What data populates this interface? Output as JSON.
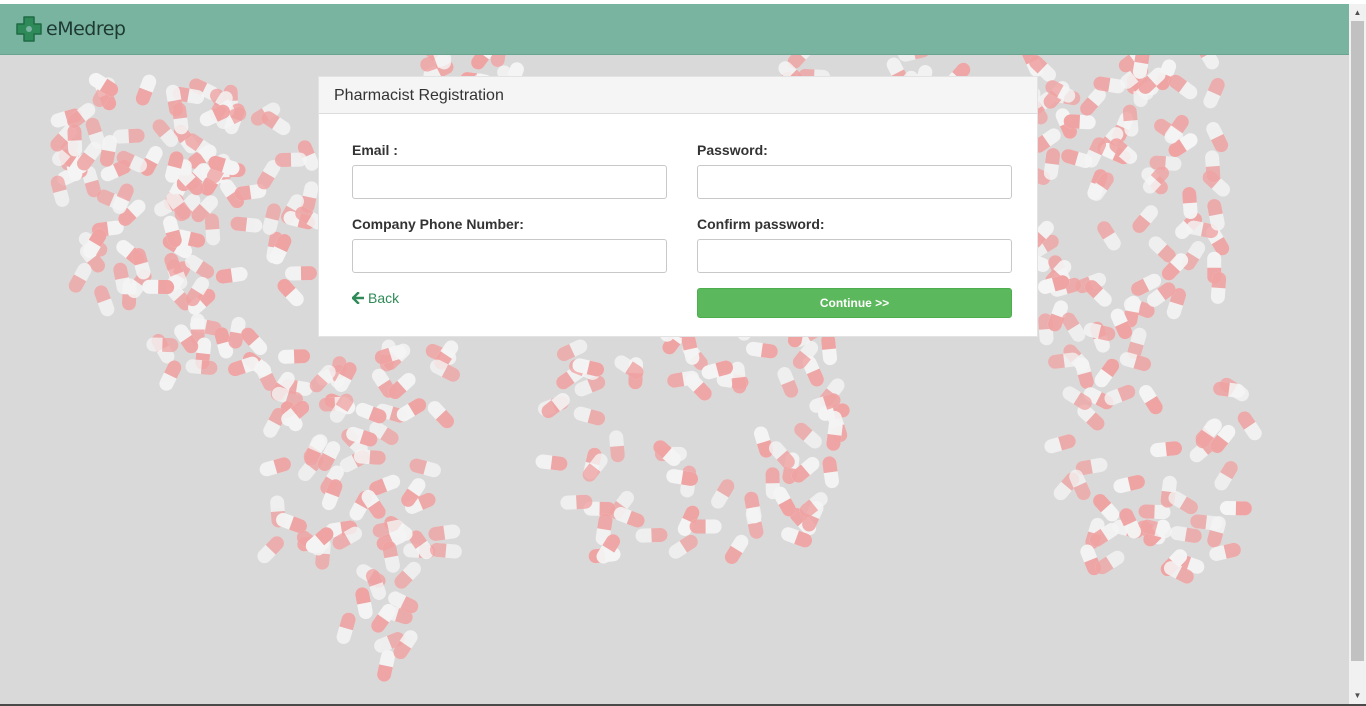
{
  "app": {
    "brand_name": "eMedrep",
    "brand_color": "#78b4a0"
  },
  "form": {
    "title": "Pharmacist Registration",
    "email_label": "Email :",
    "email_value": "",
    "password_label": "Password:",
    "password_value": "",
    "phone_label": "Company Phone Number:",
    "phone_value": "",
    "confirm_label": "Confirm password:",
    "confirm_value": "",
    "back_label": "Back",
    "back_icon": "arrow-left-icon",
    "continue_label": "Continue >>",
    "continue_color": "#5cb85c"
  },
  "scrollbar": {
    "up_icon": "▲",
    "down_icon": "▼"
  }
}
